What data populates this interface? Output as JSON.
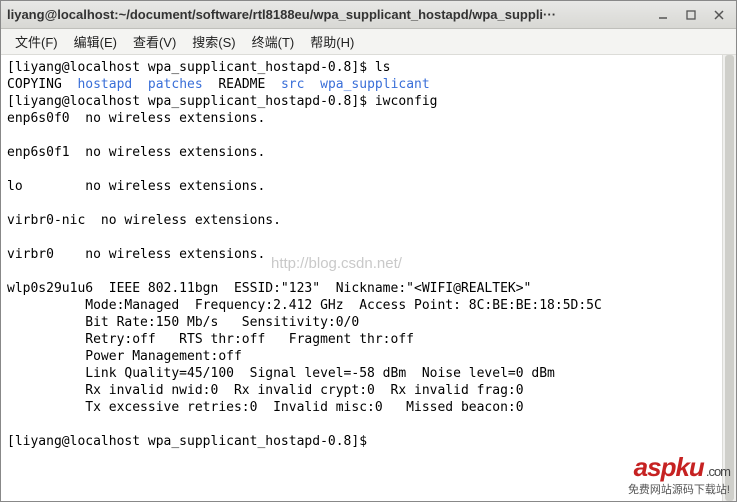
{
  "window": {
    "title": "liyang@localhost:~/document/software/rtl8188eu/wpa_supplicant_hostapd/wpa_suppli···"
  },
  "menubar": {
    "file": "文件(F)",
    "edit": "编辑(E)",
    "view": "查看(V)",
    "search": "搜索(S)",
    "terminal": "终端(T)",
    "help": "帮助(H)"
  },
  "terminal": {
    "prompt": "[liyang@localhost wpa_supplicant_hostapd-0.8]$ ",
    "cmd_ls": "ls",
    "ls_out": {
      "copying": "COPYING",
      "hostapd": "hostapd",
      "patches": "patches",
      "readme": "README",
      "src": "src",
      "wpa_supplicant": "wpa_supplicant"
    },
    "cmd_iwconfig": "iwconfig",
    "iw": {
      "l1": "enp6s0f0  no wireless extensions.",
      "l2": "",
      "l3": "enp6s0f1  no wireless extensions.",
      "l4": "",
      "l5": "lo        no wireless extensions.",
      "l6": "",
      "l7": "virbr0-nic  no wireless extensions.",
      "l8": "",
      "l9": "virbr0    no wireless extensions.",
      "l10": "",
      "l11": "wlp0s29u1u6  IEEE 802.11bgn  ESSID:\"123\"  Nickname:\"<WIFI@REALTEK>\"",
      "l12": "          Mode:Managed  Frequency:2.412 GHz  Access Point: 8C:BE:BE:18:5D:5C",
      "l13": "          Bit Rate:150 Mb/s   Sensitivity:0/0",
      "l14": "          Retry:off   RTS thr:off   Fragment thr:off",
      "l15": "          Power Management:off",
      "l16": "          Link Quality=45/100  Signal level=-58 dBm  Noise level=0 dBm",
      "l17": "          Rx invalid nwid:0  Rx invalid crypt:0  Rx invalid frag:0",
      "l18": "          Tx excessive retries:0  Invalid misc:0   Missed beacon:0",
      "l19": ""
    }
  },
  "watermark": "http://blog.csdn.net/",
  "aspku": {
    "logo": "aspku",
    "com": ".com",
    "sub": "免费网站源码下载站!"
  }
}
